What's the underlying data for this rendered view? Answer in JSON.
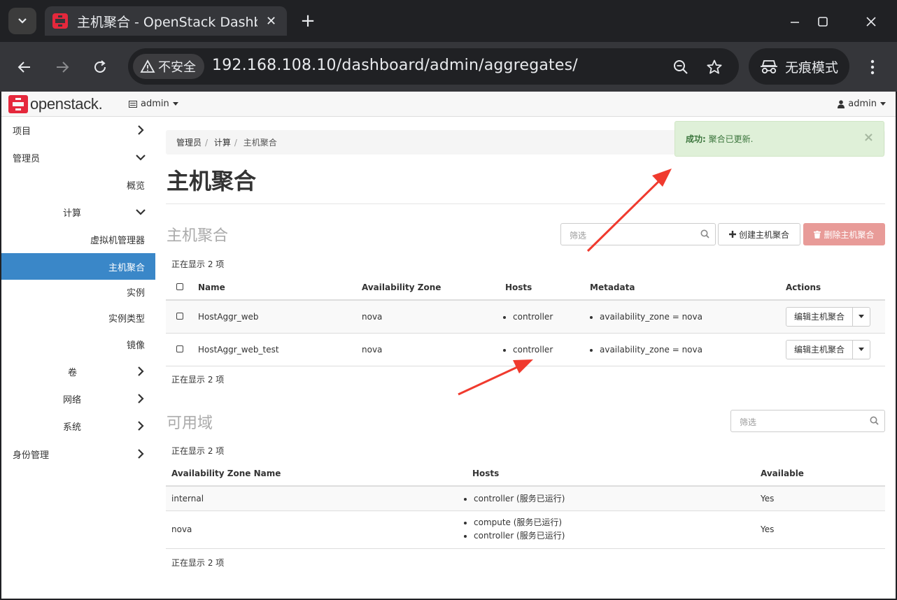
{
  "browser": {
    "tab_title": "主机聚合 - OpenStack Dashboard",
    "security_label": "不安全",
    "url": "192.168.108.10/dashboard/admin/aggregates/",
    "incognito_label": "无痕模式"
  },
  "header": {
    "logo_text": "openstack.",
    "project": "admin",
    "user": "admin"
  },
  "sidebar": {
    "items": [
      {
        "label": "项目"
      },
      {
        "label": "管理员"
      },
      {
        "label": "概览"
      },
      {
        "label": "计算"
      },
      {
        "label": "虚拟机管理器"
      },
      {
        "label": "主机聚合"
      },
      {
        "label": "实例"
      },
      {
        "label": "实例类型"
      },
      {
        "label": "镜像"
      },
      {
        "label": "卷"
      },
      {
        "label": "网络"
      },
      {
        "label": "系统"
      },
      {
        "label": "身份管理"
      }
    ]
  },
  "breadcrumb": {
    "items": [
      "管理员",
      "计算"
    ],
    "current": "主机聚合"
  },
  "page_title": "主机聚合",
  "alert": {
    "strong": "成功:",
    "message": "聚合已更新.",
    "close": "×"
  },
  "aggregates": {
    "title": "主机聚合",
    "filter_placeholder": "筛选",
    "create_label": "创建主机聚合",
    "delete_label": "删除主机聚合",
    "count_top": "正在显示 2 项",
    "count_bottom": "正在显示 2 项",
    "columns": [
      "Name",
      "Availability Zone",
      "Hosts",
      "Metadata",
      "Actions"
    ],
    "rows": [
      {
        "name": "HostAggr_web",
        "zone": "nova",
        "host": "controller",
        "metadata": "availability_zone = nova",
        "action": "编辑主机聚合"
      },
      {
        "name": "HostAggr_web_test",
        "zone": "nova",
        "host": "controller",
        "metadata": "availability_zone = nova",
        "action": "编辑主机聚合"
      }
    ]
  },
  "zones": {
    "title": "可用域",
    "filter_placeholder": "筛选",
    "count_top": "正在显示 2 项",
    "count_bottom": "正在显示 2 项",
    "columns": [
      "Availability Zone Name",
      "Hosts",
      "Available"
    ],
    "rows": [
      {
        "name": "internal",
        "hosts": [
          "controller (服务已运行)"
        ],
        "available": "Yes"
      },
      {
        "name": "nova",
        "hosts": [
          "compute (服务已运行)",
          "controller (服务已运行)"
        ],
        "available": "Yes"
      }
    ]
  },
  "colors": {
    "active_nav": "#3a87c8",
    "danger_button": "#e89b98",
    "success_bg": "#dff0d8",
    "annotation_arrow": "#f03a2e"
  }
}
